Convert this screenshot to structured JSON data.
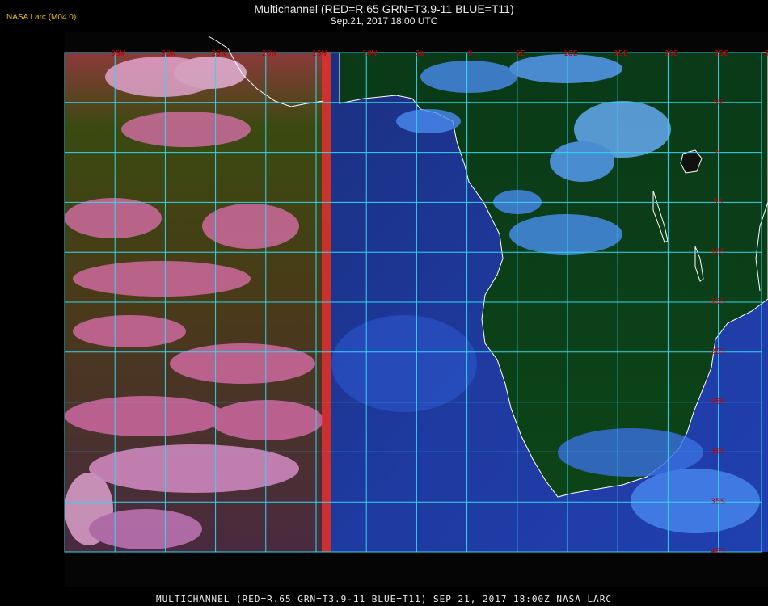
{
  "header": {
    "credit": "NASA Larc (M04.0)",
    "title": "Multichannel (RED=R.65 GRN=T3.9-11 BLUE=T11)",
    "subtitle": "Sep.21, 2017 18:00 UTC"
  },
  "map": {
    "longitude_labels": [
      "35W",
      "30W",
      "25W",
      "20W",
      "15W",
      "10W",
      "5W",
      "0",
      "5E",
      "10E",
      "15E",
      "20E",
      "25E",
      "30E",
      "35E"
    ],
    "latitude_labels": [
      "5N",
      "0",
      "5S",
      "10S",
      "15S",
      "20S",
      "25S",
      "30S",
      "35S",
      "40S"
    ],
    "grid_color": "#33d6f0",
    "coast_color": "#ffffff",
    "label_color": "#c40000"
  },
  "footer": {
    "caption": "MULTICHANNEL (RED=R.65 GRN=T3.9-11 BLUE=T11) SEP 21, 2017 18:00Z   NASA LARC"
  }
}
